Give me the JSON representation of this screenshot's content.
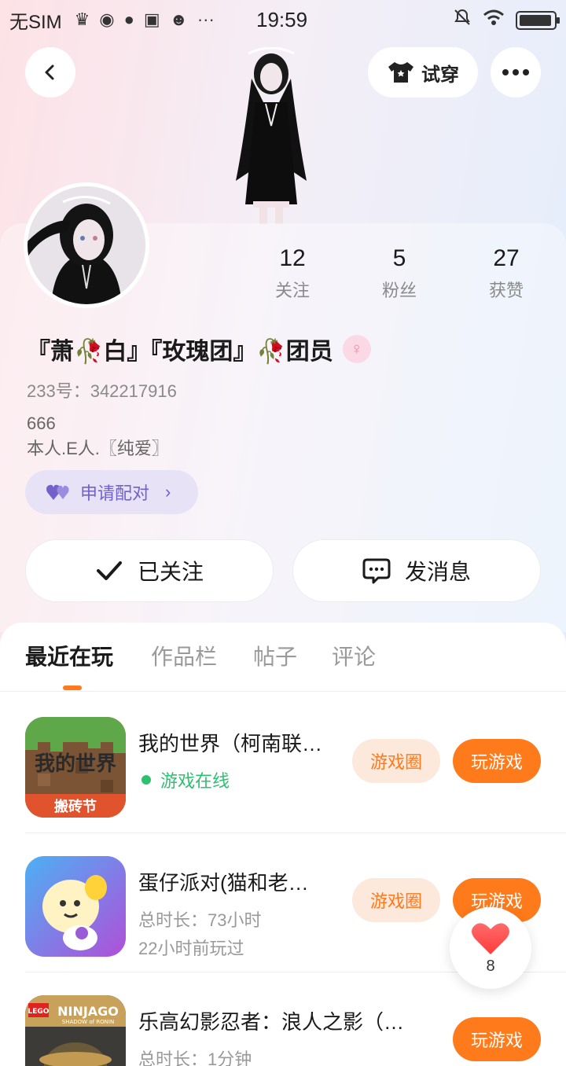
{
  "status_bar": {
    "carrier": "无SIM",
    "time": "19:59"
  },
  "header": {
    "tryon_label": "试穿"
  },
  "profile": {
    "stats": [
      {
        "value": "12",
        "label": "关注"
      },
      {
        "value": "5",
        "label": "粉丝"
      },
      {
        "value": "27",
        "label": "获赞"
      }
    ],
    "nickname": "『萧🥀白』『玫瑰团』🥀团员",
    "uid": "233号：342217916",
    "bio_line1": "666",
    "bio_line2": "本人.E人.〖纯爱〗",
    "pair_label": "申请配对",
    "follow_label": "已关注",
    "message_label": "发消息"
  },
  "tabs": [
    {
      "label": "最近在玩",
      "active": true
    },
    {
      "label": "作品栏",
      "active": false
    },
    {
      "label": "帖子",
      "active": false
    },
    {
      "label": "评论",
      "active": false
    }
  ],
  "games": [
    {
      "title": "我的世界（柯南联…",
      "status": "游戏在线",
      "circle_label": "游戏圈",
      "play_label": "玩游戏",
      "icon_text": "我的世界",
      "icon_sub": "搬砖节"
    },
    {
      "title": "蛋仔派对(猫和老…",
      "duration": "总时长：73小时",
      "last_played": "22小时前玩过",
      "circle_label": "游戏圈",
      "play_label": "玩游戏"
    },
    {
      "title": "乐高幻影忍者：浪人之影（…",
      "duration": "总时长：1分钟",
      "play_label": "玩游戏",
      "icon_text": "LEGO NINJAGO",
      "icon_sub": "SHADOW of RONIN"
    }
  ],
  "like_float": {
    "count": "8"
  },
  "colors": {
    "accent": "#ff7a1a",
    "online": "#2fbf71",
    "pair": "#7262c9"
  }
}
